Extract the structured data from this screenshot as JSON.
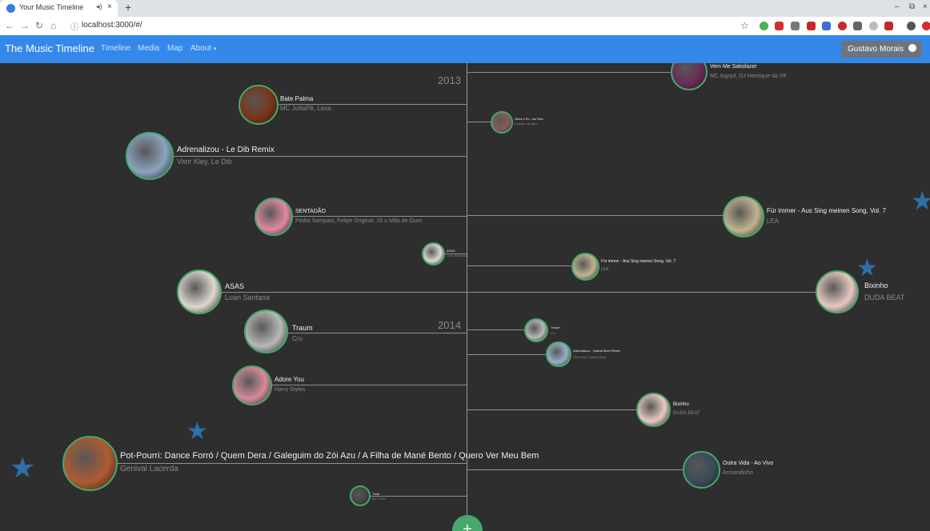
{
  "browser": {
    "tab_title": "Your Music Timeline",
    "tab_audio": "◂)",
    "tab_close": "×",
    "new_tab": "+",
    "url": "localhost:3000/#/",
    "window_controls": [
      "–",
      "⧉",
      "×"
    ],
    "nav": [
      "←",
      "→",
      "↻",
      "⌂"
    ],
    "star": "☆"
  },
  "navbar": {
    "brand": "The Music Timeline",
    "links": [
      "Timeline",
      "Media",
      "Map",
      "About"
    ],
    "about_caret": "▾",
    "user": "Gustavo Morais"
  },
  "timeline": {
    "years": [
      "2013",
      "2014"
    ],
    "tracks": [
      {
        "title": "Vem Me Satisfazer",
        "artist": "MC Ingryd, DJ Henrique da VK",
        "color": "#6a2a55"
      },
      {
        "title": "Bate Palma",
        "artist": "MC JottaPê, Lexa",
        "color": "#7a3418"
      },
      {
        "title": "Deus e Eu - Ao Vivo",
        "artist": "Leandro Borges",
        "color": "#8a5a5a"
      },
      {
        "title": "Adrenalizou - Le Dib Remix",
        "artist": "Vitor Kley, Le Dib",
        "color": "#8ba3c0"
      },
      {
        "title": "SENTADÃO",
        "artist": "Pedro Sampaio, Felipe Original, JS o Mão de Ouro",
        "color": "#e08aa0"
      },
      {
        "title": "Für immer - Aus Sing meinen Song, Vol. 7",
        "artist": "LEA",
        "color": "#c0b490"
      },
      {
        "title": "ASAS",
        "artist": "Luan Santana",
        "color": "#ddd8d0"
      },
      {
        "title": "Für immer - Aus Sing meinen Song, Vol. 7",
        "artist": "LEA",
        "color": "#c0b490"
      },
      {
        "title": "ASAS",
        "artist": "Luan Santana",
        "color": "#ddd8d0"
      },
      {
        "title": "Bixinho",
        "artist": "DUDA BEAT",
        "color": "#e8c8c0"
      },
      {
        "title": "Traum",
        "artist": "Cro",
        "color": "#b8b8b8"
      },
      {
        "title": "Traum",
        "artist": "Cro",
        "color": "#b8b8b8"
      },
      {
        "title": "Adrenalizou - Gabriel Boni Remix",
        "artist": "Vitor Kley, Gabriel Boni",
        "color": "#9ab0c8"
      },
      {
        "title": "Adore You",
        "artist": "Harry Styles",
        "color": "#d88a9a"
      },
      {
        "title": "Bixinho",
        "artist": "DUDA BEAT",
        "color": "#e8c8c0"
      },
      {
        "title": "Pot-Pourri: Dance Forró / Quem Dera / Galeguim do Zói Azu / A Filha de Mané Bento / Quero Ver Meu Bem",
        "artist": "Genival Lacerda",
        "color": "#b05a30"
      },
      {
        "title": "Outra Vida - Ao Vivo",
        "artist": "Armandinho",
        "color": "#3a4a5a"
      },
      {
        "title": "Tudo",
        "artist": "MC Kevin",
        "color": "#444444"
      }
    ],
    "add_label": "+"
  },
  "icons": {
    "star": "★",
    "cursor": "🖰"
  }
}
